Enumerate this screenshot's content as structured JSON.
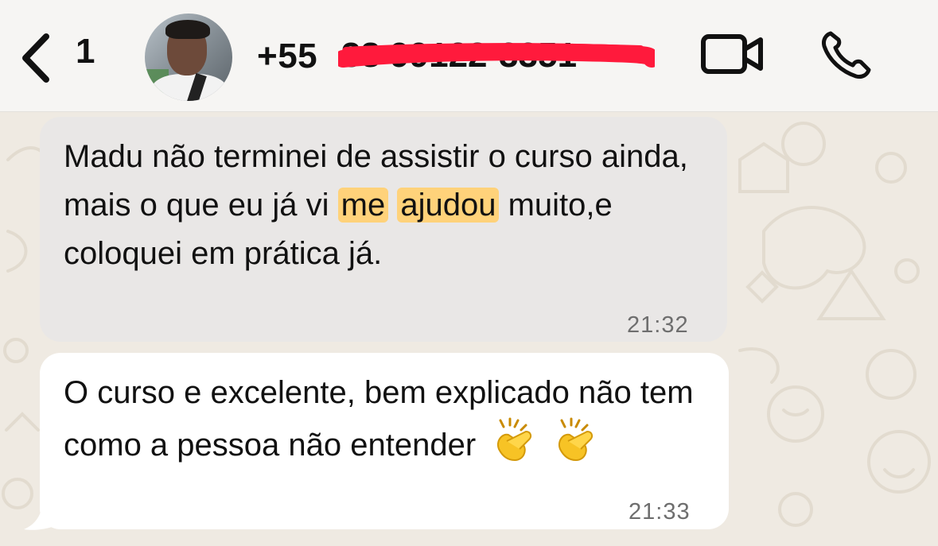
{
  "header": {
    "back_count": "1",
    "contact_number_prefix": "+55",
    "redacted_number": "38 99122-3351"
  },
  "messages": [
    {
      "text_before": "Madu não terminei de assistir o curso ainda, mais o que eu já vi ",
      "highlight_1": "me",
      "space": " ",
      "highlight_2": "ajudou",
      "text_after": " muito,e coloquei em prática já.",
      "time": "21:32"
    },
    {
      "text": "O curso e excelente, bem explicado não tem como a pessoa não entender",
      "emoji_count": 2,
      "emoji_name": "clapping-hands",
      "time": "21:33"
    }
  ],
  "colors": {
    "header_bg": "#f6f5f3",
    "chat_bg": "#efeae2",
    "bubble_grey": "#e9e7e6",
    "bubble_white": "#ffffff",
    "highlight": "#ffd27a",
    "redaction": "#ff1a3c"
  }
}
